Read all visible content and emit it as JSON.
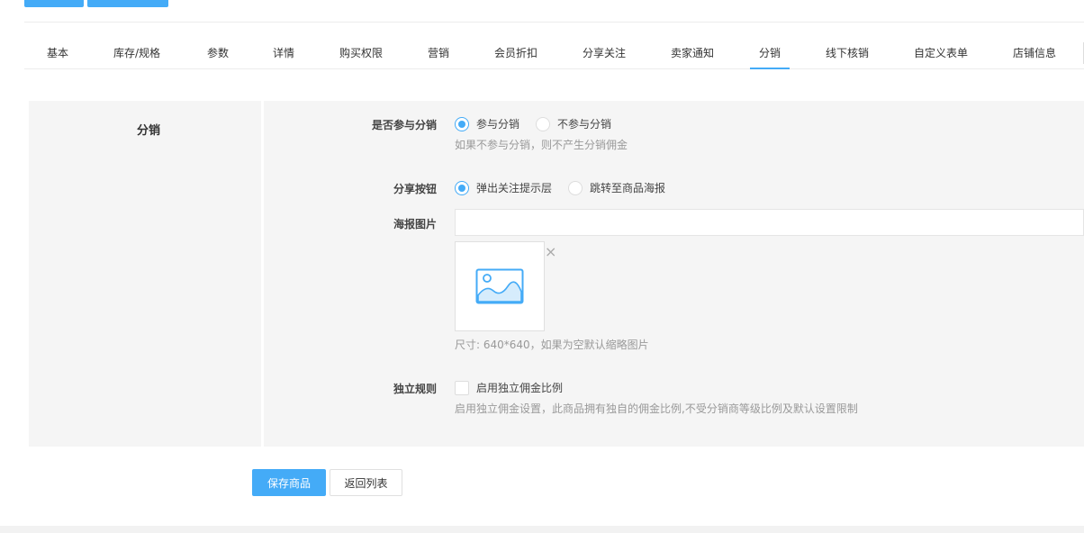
{
  "tabs": {
    "items": [
      "基本",
      "库存/规格",
      "参数",
      "详情",
      "购买权限",
      "营销",
      "会员折扣",
      "分享关注",
      "卖家通知",
      "分销",
      "线下核销",
      "自定义表单",
      "店铺信息"
    ],
    "active": "分销"
  },
  "section": {
    "title": "分销"
  },
  "participate": {
    "label": "是否参与分销",
    "option_yes": "参与分销",
    "option_no": "不参与分销",
    "selected": "参与分销",
    "help": "如果不参与分销，则不产生分销佣金"
  },
  "share_button": {
    "label": "分享按钮",
    "option_popup": "弹出关注提示层",
    "option_poster": "跳转至商品海报",
    "selected": "弹出关注提示层"
  },
  "poster": {
    "label": "海报图片",
    "input_value": "",
    "close": "×",
    "help": "尺寸: 640*640，如果为空默认缩略图片"
  },
  "independent_rule": {
    "label": "独立规则",
    "checkbox_label": "启用独立佣金比例",
    "checked": false,
    "help": "启用独立佣金设置，此商品拥有独自的佣金比例,不受分销商等级比例及默认设置限制"
  },
  "actions": {
    "save": "保存商品",
    "back": "返回列表"
  },
  "colors": {
    "accent": "#44abf7",
    "panel_bg": "#f5f5f5"
  }
}
